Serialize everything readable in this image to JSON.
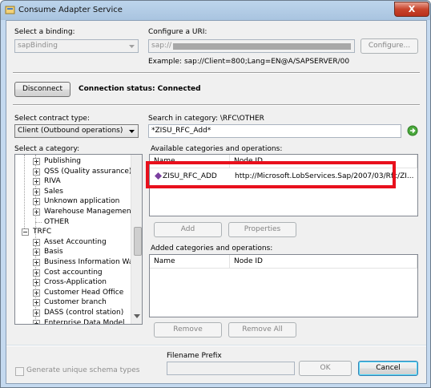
{
  "window": {
    "title": "Consume Adapter Service",
    "close_label": "X"
  },
  "binding": {
    "label": "Select a binding:",
    "value": "sapBinding"
  },
  "uri": {
    "label": "Configure a URI:",
    "value": "sap://",
    "configure_button": "Configure...",
    "example": "Example: sap://Client=800;Lang=EN@A/SAPSERVER/00"
  },
  "connection": {
    "disconnect_button": "Disconnect",
    "status": "Connection status: Connected"
  },
  "contract": {
    "label": "Select contract type:",
    "value": "Client (Outbound operations)"
  },
  "search": {
    "label": "Search in category: \\RFC\\OTHER",
    "value": "*ZISU_RFC_Add*"
  },
  "category": {
    "label": "Select a category:",
    "items": [
      {
        "label": "Publishing",
        "expandable": true
      },
      {
        "label": "QSS (Quality assurance)",
        "expandable": true
      },
      {
        "label": "RIVA",
        "expandable": true
      },
      {
        "label": "Sales",
        "expandable": true
      },
      {
        "label": "Unknown application",
        "expandable": true
      },
      {
        "label": "Warehouse Management",
        "expandable": true
      },
      {
        "label": "OTHER",
        "expandable": false
      },
      {
        "label": "TRFC",
        "expandable": true,
        "expanded": true,
        "root": true
      },
      {
        "label": "Asset Accounting",
        "expandable": true
      },
      {
        "label": "Basis",
        "expandable": true
      },
      {
        "label": "Business Information Warehouse",
        "expandable": true
      },
      {
        "label": "Cost accounting",
        "expandable": true
      },
      {
        "label": "Cross-Application",
        "expandable": true
      },
      {
        "label": "Customer Head Office",
        "expandable": true
      },
      {
        "label": "Customer branch",
        "expandable": true
      },
      {
        "label": "DASS (control station)",
        "expandable": true
      },
      {
        "label": "Enterprise Data Model",
        "expandable": true
      }
    ]
  },
  "available": {
    "label": "Available categories and operations:",
    "col_name": "Name",
    "col_node": "Node ID",
    "rows": [
      {
        "name": "ZISU_RFC_ADD",
        "node": "http://Microsoft.LobServices.Sap/2007/03/Rfc/ZI..."
      }
    ],
    "highlight_color": "#e8101c"
  },
  "actions": {
    "add_button": "Add",
    "properties_button": "Properties",
    "remove_button": "Remove",
    "remove_all_button": "Remove All"
  },
  "added": {
    "label": "Added categories and operations:",
    "col_name": "Name",
    "col_node": "Node ID"
  },
  "footer": {
    "generate_label": "Generate unique schema types",
    "filename_label": "Filename Prefix",
    "filename_value": "",
    "ok_button": "OK",
    "cancel_button": "Cancel"
  }
}
